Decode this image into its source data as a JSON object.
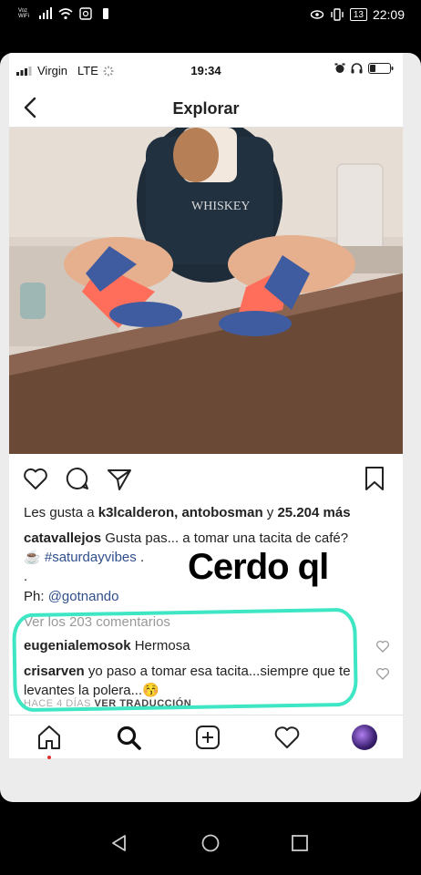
{
  "android_status": {
    "vowifi": "Voz WiFi",
    "battery": "13",
    "time": "22:09"
  },
  "ios_status": {
    "carrier": "Virgin",
    "network": "LTE",
    "time": "19:34"
  },
  "navbar": {
    "title": "Explorar"
  },
  "post": {
    "likes_prefix": "Les gusta a",
    "likes_users": "k3lcalderon, antobosman",
    "likes_and": "y",
    "likes_count": "25.204 más",
    "caption_user": "catavallejos",
    "caption_text": "Gusta pas... a tomar una tacita de café?",
    "caption_emoji": "☕",
    "caption_hashtag": "#saturdayvibes",
    "caption_end": ".",
    "dot": ".",
    "ph_label": "Ph:",
    "ph_mention": "@gotnando",
    "view_all": "Ver los 203 comentarios",
    "comments": [
      {
        "user": "eugenialemosok",
        "text": "Hermosa"
      },
      {
        "user": "crisarven",
        "text": "yo paso a tomar esa tacita...siempre que te levantes la polera...😚"
      }
    ],
    "meta_time": "HACE 4 DÍAS",
    "meta_translate": "VER TRADUCCIÓN"
  },
  "overlay": {
    "text": "Cerdo ql"
  },
  "colors": {
    "highlight": "#3ee6c3",
    "link": "#2f4f8c",
    "active_dot": "#e0302f"
  }
}
